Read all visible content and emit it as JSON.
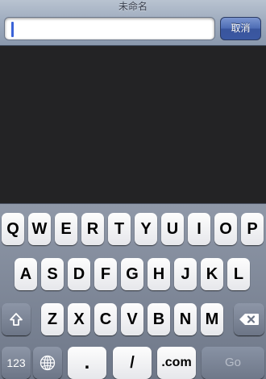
{
  "topbar": {
    "title": "未命名",
    "search_value": "",
    "cancel_label": "取消"
  },
  "keyboard": {
    "row1": [
      "Q",
      "W",
      "E",
      "R",
      "T",
      "Y",
      "U",
      "I",
      "O",
      "P"
    ],
    "row2": [
      "A",
      "S",
      "D",
      "F",
      "G",
      "H",
      "J",
      "K",
      "L"
    ],
    "row3": [
      "Z",
      "X",
      "C",
      "V",
      "B",
      "N",
      "M"
    ],
    "numbers_label": "123",
    "period_label": ".",
    "slash_label": "/",
    "dotcom_label": ".com",
    "go_label": "Go",
    "icons": {
      "shift": "shift-arrow-icon",
      "delete": "backspace-icon",
      "globe": "globe-icon"
    }
  },
  "colors": {
    "topbar": "#9eabbe",
    "cancel_button": "#4c6bb4",
    "content_background": "#232325",
    "keyboard_background": "#7d8697",
    "caret": "#3a63d8"
  }
}
